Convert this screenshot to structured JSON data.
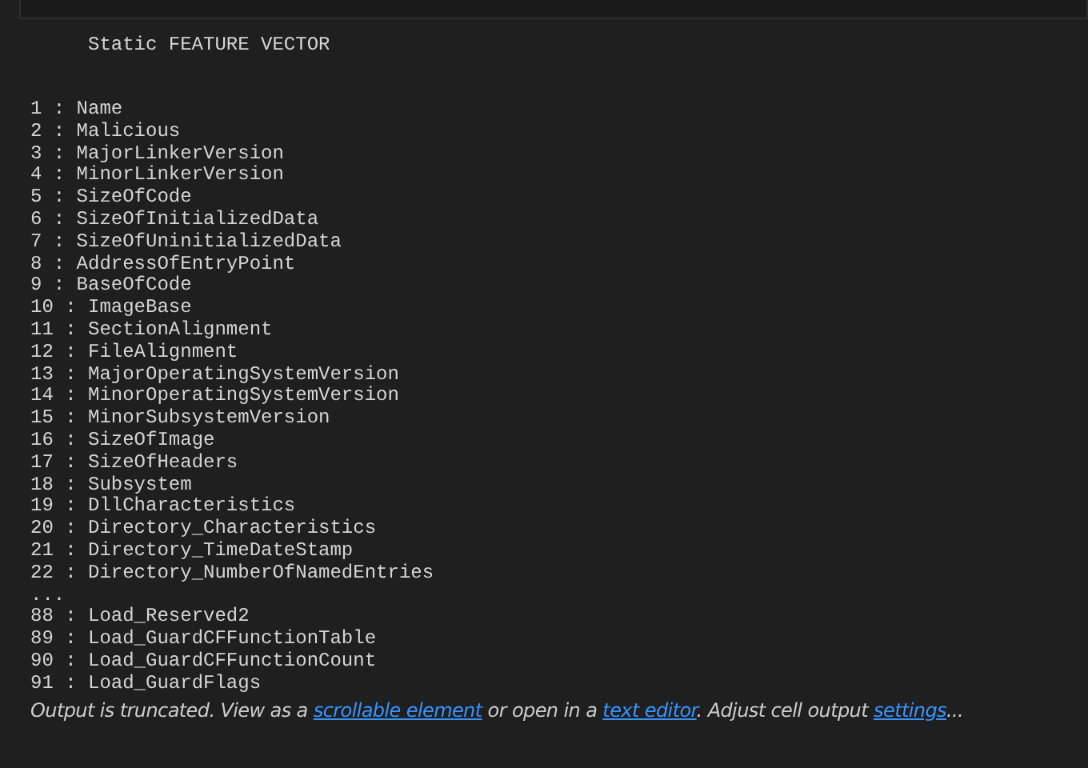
{
  "output": {
    "title": "Static FEATURE VECTOR",
    "lines": [
      "1 : Name",
      "2 : Malicious",
      "3 : MajorLinkerVersion",
      "4 : MinorLinkerVersion",
      "5 : SizeOfCode",
      "6 : SizeOfInitializedData",
      "7 : SizeOfUninitializedData",
      "8 : AddressOfEntryPoint",
      "9 : BaseOfCode",
      "10 : ImageBase",
      "11 : SectionAlignment",
      "12 : FileAlignment",
      "13 : MajorOperatingSystemVersion",
      "14 : MinorOperatingSystemVersion",
      "15 : MinorSubsystemVersion",
      "16 : SizeOfImage",
      "17 : SizeOfHeaders",
      "18 : Subsystem",
      "19 : DllCharacteristics",
      "20 : Directory_Characteristics",
      "21 : Directory_TimeDateStamp",
      "22 : Directory_NumberOfNamedEntries",
      "...",
      "88 : Load_Reserved2",
      "89 : Load_GuardCFFunctionTable",
      "90 : Load_GuardCFFunctionCount",
      "91 : Load_GuardFlags"
    ],
    "notice": [
      {
        "kind": "text",
        "text": "Output is truncated. View as a "
      },
      {
        "kind": "link",
        "text": "scrollable element"
      },
      {
        "kind": "text",
        "text": " or open in a "
      },
      {
        "kind": "link",
        "text": "text editor"
      },
      {
        "kind": "text",
        "text": ". Adjust cell output "
      },
      {
        "kind": "link",
        "text": "settings"
      },
      {
        "kind": "text",
        "text": "..."
      }
    ]
  }
}
